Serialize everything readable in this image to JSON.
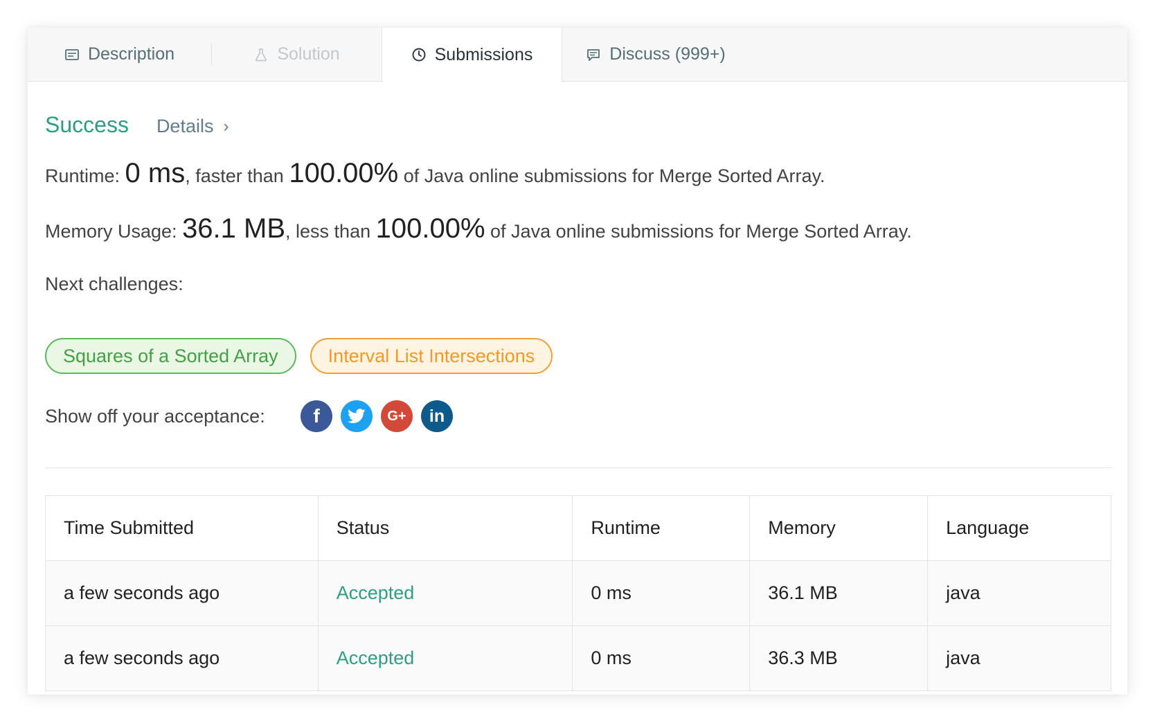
{
  "tabs": [
    {
      "label": "Description",
      "icon": "description-icon"
    },
    {
      "label": "Solution",
      "icon": "flask-icon",
      "disabled": true
    },
    {
      "label": "Submissions",
      "icon": "clock-icon",
      "active": true
    },
    {
      "label": "Discuss (999+)",
      "icon": "comment-icon"
    }
  ],
  "result": {
    "status": "Success",
    "details_label": "Details",
    "details_chevron": "›"
  },
  "runtime": {
    "label": "Runtime: ",
    "value": "0 ms",
    "mid": ", faster than ",
    "percent": "100.00%",
    "tail": " of Java online submissions for Merge Sorted Array."
  },
  "memory": {
    "label": "Memory Usage: ",
    "value": "36.1 MB",
    "mid": ", less than ",
    "percent": "100.00%",
    "tail": " of Java online submissions for Merge Sorted Array."
  },
  "challenges": {
    "heading": "Next challenges:",
    "items": [
      {
        "label": "Squares of a Sorted Array",
        "difficulty": "easy",
        "color": "#5cb85c"
      },
      {
        "label": "Interval List Intersections",
        "difficulty": "medium",
        "color": "#f0a030"
      }
    ]
  },
  "share": {
    "label": "Show off your acceptance:",
    "networks": [
      {
        "icon": "facebook-icon",
        "glyph": "f",
        "color": "#3b5998"
      },
      {
        "icon": "twitter-icon",
        "color": "#1da1f2"
      },
      {
        "icon": "google-plus-icon",
        "glyph": "G+",
        "color": "#d34836"
      },
      {
        "icon": "linkedin-icon",
        "glyph": "in",
        "color": "#0e5a8a"
      }
    ]
  },
  "table": {
    "headers": [
      "Time Submitted",
      "Status",
      "Runtime",
      "Memory",
      "Language"
    ],
    "rows": [
      [
        "a few seconds ago",
        "Accepted",
        "0 ms",
        "36.1 MB",
        "java"
      ],
      [
        "a few seconds ago",
        "Accepted",
        "0 ms",
        "36.3 MB",
        "java"
      ]
    ]
  },
  "colors": {
    "accent": "#2e9e83",
    "easy": "#5cb85c",
    "medium": "#f0a030"
  }
}
